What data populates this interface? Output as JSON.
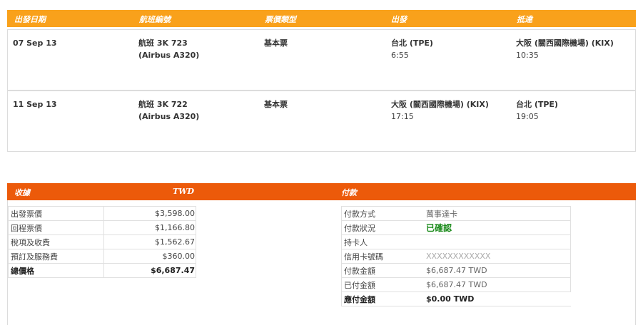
{
  "flights": {
    "headers": [
      "出發日期",
      "航班編號",
      "票價類型",
      "出發",
      "抵達"
    ],
    "rows": [
      {
        "date": "07 Sep 13",
        "flight": "航班 3K 723",
        "aircraft": "(Airbus A320)",
        "fare": "基本票",
        "depart_place": "台北 (TPE)",
        "depart_time": "6:55",
        "arrive_place": "大阪 (關西國際機場) (KIX)",
        "arrive_time": "10:35"
      },
      {
        "date": "11 Sep 13",
        "flight": "航班 3K 722",
        "aircraft": "(Airbus A320)",
        "fare": "基本票",
        "depart_place": "大阪 (關西國際機場) (KIX)",
        "depart_time": "17:15",
        "arrive_place": "台北 (TPE)",
        "arrive_time": "19:05"
      }
    ]
  },
  "charges": {
    "title": "收據",
    "currency": "TWD",
    "items": [
      {
        "label": "出發票價",
        "amount": "$3,598.00"
      },
      {
        "label": "回程票價",
        "amount": "$1,166.80"
      },
      {
        "label": "稅項及收費",
        "amount": "$1,562.67"
      },
      {
        "label": "預訂及服務費",
        "amount": "$360.00"
      }
    ],
    "total": {
      "label": "總價格",
      "amount": "$6,687.47"
    }
  },
  "payment": {
    "title": "付款",
    "rows": [
      {
        "label": "付款方式",
        "value": "萬事達卡"
      },
      {
        "label": "付款狀況",
        "value": "已確認"
      },
      {
        "label": "持卡人",
        "value": ""
      },
      {
        "label": "信用卡號碼",
        "value": "XXXXXXXXXXXX"
      },
      {
        "label": "付款金額",
        "value": "$6,687.47 TWD"
      },
      {
        "label": "已付金額",
        "value": "$6,687.47 TWD"
      }
    ],
    "due": {
      "label": "應付金額",
      "value": "$0.00  TWD"
    }
  },
  "colors": {
    "flight_header": "#f9a11b",
    "section_header": "#ec5a0a",
    "confirmed": "#1a8a1a"
  }
}
